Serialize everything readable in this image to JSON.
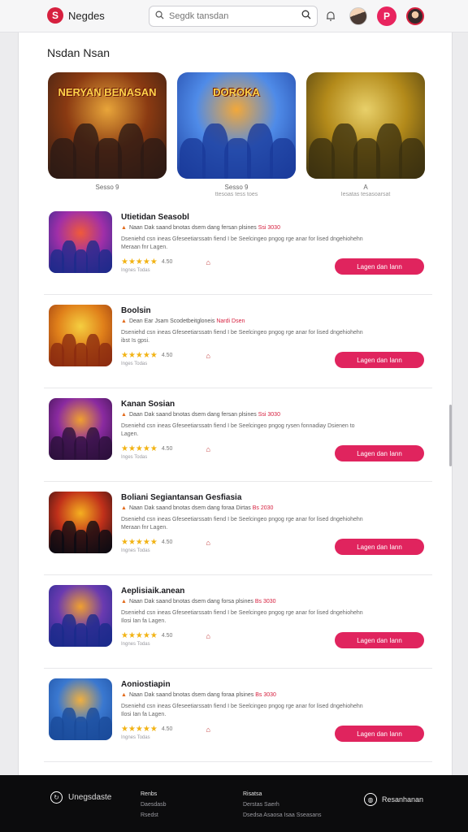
{
  "header": {
    "brand": "Negdes",
    "logo_glyph": "S",
    "search_placeholder": "Segdk tansdan",
    "profile_badge": "P"
  },
  "featured": {
    "title": "Nsdan Nsan",
    "items": [
      {
        "caption": "Sesso 9",
        "sub": "",
        "art_text": "NERYAN BENASAN",
        "colors": [
          "#2b1a14",
          "#8a3a12",
          "#e8a53a"
        ]
      },
      {
        "caption": "Sesso 9",
        "sub": "ttesoas tess toes",
        "art_text": "DOROKA",
        "colors": [
          "#1a3a9a",
          "#4f8be8",
          "#f2a83a"
        ]
      },
      {
        "caption": "A",
        "sub": "Iesatas tesasoarsat",
        "art_text": "",
        "colors": [
          "#3a3010",
          "#b38a1a",
          "#e8d06a"
        ]
      }
    ]
  },
  "apps": [
    {
      "title": "Utietidan Seasobl",
      "meta_prefix": "Naan Dak saand bnotas dsem dang fersan plsines",
      "meta_highlight": "Ssi 3030",
      "desc": "Dseniehd csn ineas Gfeseetiarssatn fiend I be Seelcingeo pngog rge anar for lised dngehiohehn Meraan fnr Lagen.",
      "score": "4.50",
      "foot": "Ingnes Todas",
      "cta": "Lagen dan Iann",
      "colors": [
        "#1c2a8a",
        "#a02fa8",
        "#f05a3a"
      ]
    },
    {
      "title": "Boolsin",
      "meta_prefix": "Dean Ear Jsam Scodetbeitgloneis",
      "meta_highlight": "Nardi Dsen",
      "desc": "Dseniehd csn ineas Gfeseetiarssatn fiend I be Seelcingeo pngog rge anar for lised dngehiohehn ibst Is gpsi.",
      "score": "4.50",
      "foot": "Inges Todas",
      "cta": "Lagen dan Iann",
      "colors": [
        "#8a2a10",
        "#e0801a",
        "#f5cf40"
      ]
    },
    {
      "title": "Kanan Sosian",
      "meta_prefix": "Daan Dak saand bnotas dsem dang fersan plsines",
      "meta_highlight": "Ssi 3030",
      "desc": "Dseniehd csn ineas Gfeseetiarssatn fiend I be Seelcingeo pngog rysen fonnadiay Dsienen to Lagen.",
      "score": "4.50",
      "foot": "Inges Todas",
      "cta": "Lagen dan Iann",
      "colors": [
        "#2a0f3a",
        "#8a2aa0",
        "#f0a030"
      ]
    },
    {
      "title": "Boliani Segiantansan Gesfiasia",
      "meta_prefix": "Naan Dak saand bnotas dsem dang foraa Dirtas",
      "meta_highlight": "Bs 2030",
      "desc": "Dseniehd csn ineas Gfeseetiarssatn fiend I be Seelcingeo pngog rge anar for lised dngehiohehn Meraan fnr Lagen.",
      "score": "4.50",
      "foot": "Ingnes Todas",
      "cta": "Lagen dan Iann",
      "colors": [
        "#0a0a12",
        "#c0301a",
        "#f5b020"
      ]
    },
    {
      "title": "Aeplisiaik.anean",
      "meta_prefix": "Naan Dak saand bnotas dsem dang forsa plsines",
      "meta_highlight": "Bs 3030",
      "desc": "Dseniehd csn ineas Gfeseetiarssatn fiend I be Seelcingeo pngog rge anar for lised dngehiohehn Ilosi Ian fa Lagen.",
      "score": "4.50",
      "foot": "Ingnes Todas",
      "cta": "Lagen dan Iann",
      "colors": [
        "#1a2a8a",
        "#6a3ab0",
        "#f0a030"
      ]
    },
    {
      "title": "Aoniostiapin",
      "meta_prefix": "Naan Dak saand bnotas dsem dang foraa plsines",
      "meta_highlight": "Bs 3030",
      "desc": "Dseniehd csn ineas Gfeseetiarssatn fiend I be Seelcingeo pngog rge anar for lised dngehiohehn Ilosi Ian fa Lagen.",
      "score": "4.50",
      "foot": "Ingnes Todas",
      "cta": "Lagen dan Iann",
      "colors": [
        "#1a4a9a",
        "#3a78d0",
        "#f0b040"
      ]
    }
  ],
  "footer": {
    "brand": "Unegsdaste",
    "col1": {
      "title": "Renbs",
      "items": [
        "Daesdasb",
        "Rsedst"
      ]
    },
    "col2": {
      "title": "Risatsa",
      "items": [
        "Derstas Saerh",
        "Dsedsa Asaosa Isaa Sseasans"
      ]
    },
    "right_label": "Resanhanan"
  }
}
